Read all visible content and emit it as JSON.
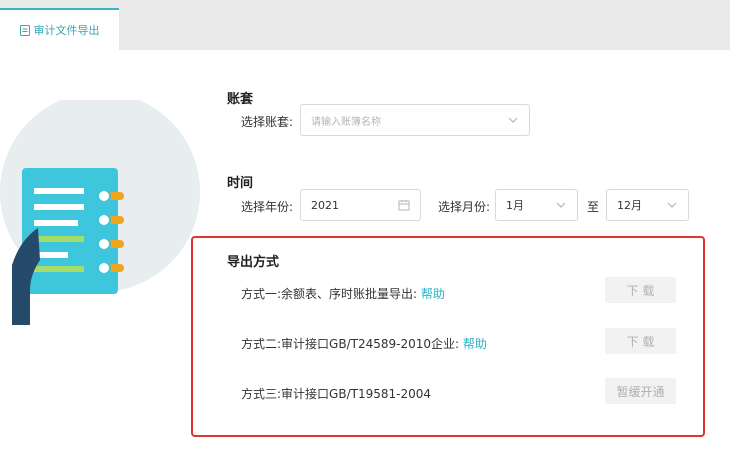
{
  "tab": {
    "label": "审计文件导出",
    "accent": "#37b6c4"
  },
  "account": {
    "title": "账套",
    "select_label": "选择账套:",
    "placeholder": "请输入账簿名称"
  },
  "time": {
    "title": "时间",
    "year_label": "选择年份:",
    "year_value": "2021",
    "month_label": "选择月份:",
    "month_from": "1月",
    "to_label": "至",
    "month_to": "12月"
  },
  "export": {
    "title": "导出方式",
    "methods": [
      {
        "label": "方式一:余额表、序时账批量导出:",
        "help": "帮助",
        "button": "下 载"
      },
      {
        "label": "方式二:审计接口GB/T24589-2010企业:",
        "help": "帮助",
        "button": "下 载"
      },
      {
        "label": "方式三:审计接口GB/T19581-2004",
        "help": "",
        "button": "暂缓开通"
      }
    ],
    "highlight_color": "#e0342f"
  },
  "icons": [
    "document-icon",
    "calendar-icon",
    "chevron-down-icon",
    "notebook-illustration"
  ]
}
